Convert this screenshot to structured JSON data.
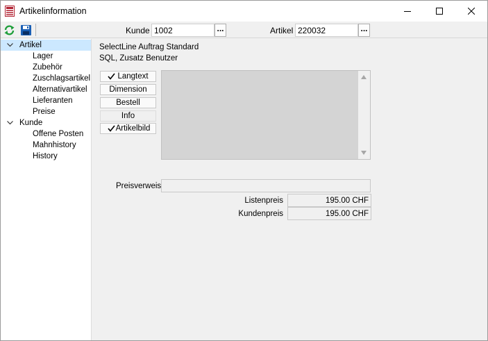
{
  "window": {
    "title": "Artikelinformation"
  },
  "toolbar": {
    "kunde_label": "Kunde",
    "kunde_value": "1002",
    "artikel_label": "Artikel",
    "artikel_value": "220032",
    "lookup_label": "..."
  },
  "tree": {
    "items": [
      {
        "label": "Artikel",
        "level": 0,
        "expanded": true,
        "selected": true
      },
      {
        "label": "Lager",
        "level": 1
      },
      {
        "label": "Zubehör",
        "level": 1
      },
      {
        "label": "Zuschlagsartikel",
        "level": 1
      },
      {
        "label": "Alternativartikel",
        "level": 1
      },
      {
        "label": "Lieferanten",
        "level": 1
      },
      {
        "label": "Preise",
        "level": 1
      },
      {
        "label": "Kunde",
        "level": 0,
        "expanded": true
      },
      {
        "label": "Offene Posten",
        "level": 1
      },
      {
        "label": "Mahnhistory",
        "level": 1
      },
      {
        "label": "History",
        "level": 1
      }
    ]
  },
  "content": {
    "info_line_1": "SelectLine Auftrag Standard",
    "info_line_2": "SQL, Zusatz Benutzer",
    "buttons": [
      {
        "label": "Langtext",
        "checked": true
      },
      {
        "label": "Dimension",
        "checked": false
      },
      {
        "label": "Bestell",
        "checked": false
      },
      {
        "label": "Info",
        "checked": false
      },
      {
        "label": "Artikelbild",
        "checked": true
      }
    ],
    "preisverweis_label": "Preisverweis",
    "preisverweis_value": "",
    "listenpreis_label": "Listenpreis",
    "listenpreis_value": "195.00 CHF",
    "kundenpreis_label": "Kundenpreis",
    "kundenpreis_value": "195.00 CHF"
  },
  "colors": {
    "selection": "#cce8ff",
    "refresh_green": "#1e9e3a",
    "save_blue": "#1a5fb4"
  }
}
